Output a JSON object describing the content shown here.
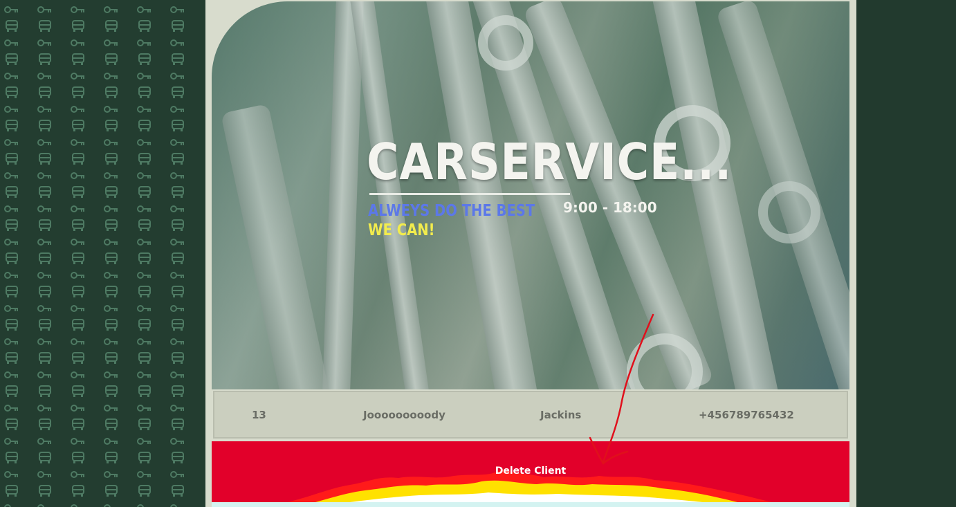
{
  "header": {
    "title": "CARSERVICE...",
    "slogan_line1": "ALWEYS DO THE BEST",
    "slogan_line2": "WE CAN!",
    "hours": "9:00 - 18:00"
  },
  "client": {
    "id": "13",
    "first_name": "Jooooooooody",
    "last_name": "Jackins",
    "phone": "+456789765432"
  },
  "actions": {
    "delete_label": "Delete Client"
  },
  "colors": {
    "background_dark": "#223a2e",
    "frame": "#d8dccd",
    "slogan_blue": "#5c78e8",
    "slogan_yellow": "#f2ec4d",
    "delete_red": "#e2002a",
    "annotation_arrow": "#e0101c"
  },
  "icons": {
    "pattern": [
      "car-icon",
      "key-icon"
    ],
    "annotation": "red-arrow-annotation"
  }
}
